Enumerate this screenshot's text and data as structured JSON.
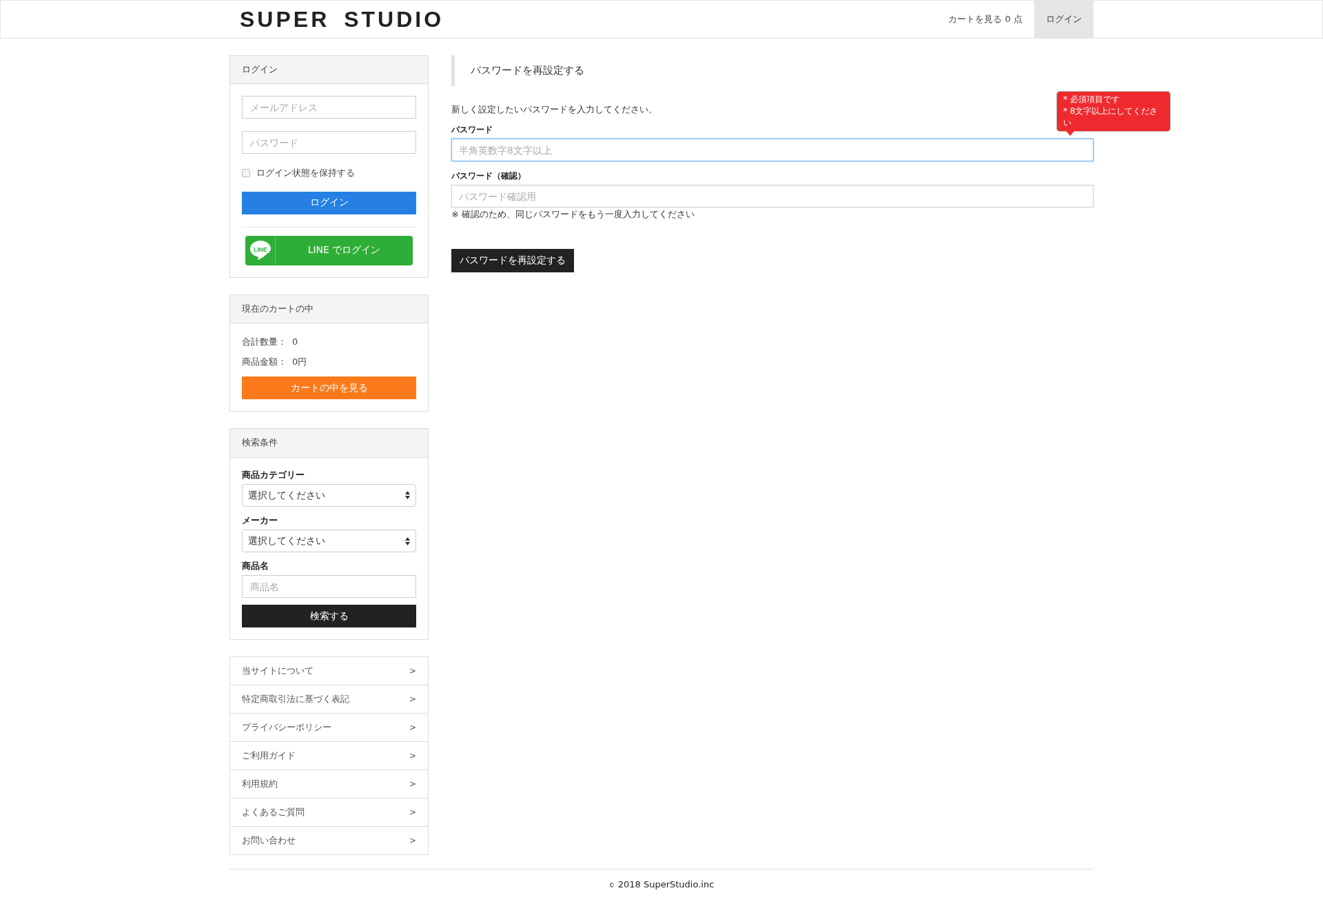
{
  "header": {
    "logo": "SUPER STUDIO",
    "cart_link": "カートを見る 0 点",
    "login_link": "ログイン"
  },
  "login_panel": {
    "title": "ログイン",
    "email": {
      "placeholder": "メールアドレス"
    },
    "password": {
      "placeholder": "パスワード"
    },
    "remember": {
      "label": "ログイン状態を保持する",
      "checked": false
    },
    "login_button": "ログイン",
    "line_button": {
      "badge": "LINE",
      "label": "LINE でログイン"
    }
  },
  "cart_panel": {
    "title": "現在のカートの中",
    "rows": [
      {
        "label": "合計数量：",
        "value": "0"
      },
      {
        "label": "商品金額：",
        "value": "0円"
      }
    ],
    "button": "カートの中を見る"
  },
  "search_panel": {
    "title": "検索条件",
    "fields": [
      {
        "kind": "select",
        "label": "商品カテゴリー",
        "value": "選択してください"
      },
      {
        "kind": "select",
        "label": "メーカー",
        "value": "選択してください"
      },
      {
        "kind": "text",
        "label": "商品名",
        "placeholder": "商品名"
      }
    ],
    "button": "検索する"
  },
  "links": [
    "当サイトについて",
    "特定商取引法に基づく表記",
    "プライバシーポリシー",
    "ご利用ガイド",
    "利用規約",
    "よくあるご質問",
    "お問い合わせ"
  ],
  "link_arrow": ">",
  "main": {
    "heading": "パスワードを再設定する",
    "description": "新しく設定したいパスワードを入力してください。",
    "fields": [
      {
        "label": "パスワード",
        "placeholder": "半角英数字8文字以上",
        "focused": true,
        "errors": [
          "* 必須項目です",
          "* 8文字以上にしてください"
        ]
      },
      {
        "label": "パスワード（確認）",
        "placeholder": "パスワード確認用",
        "focused": false,
        "note": "※ 確認のため、同じパスワードをもう一度入力してください"
      }
    ],
    "submit": "パスワードを再設定する"
  },
  "footer": {
    "mark": "©",
    "text": "2018 SuperStudio.inc"
  }
}
